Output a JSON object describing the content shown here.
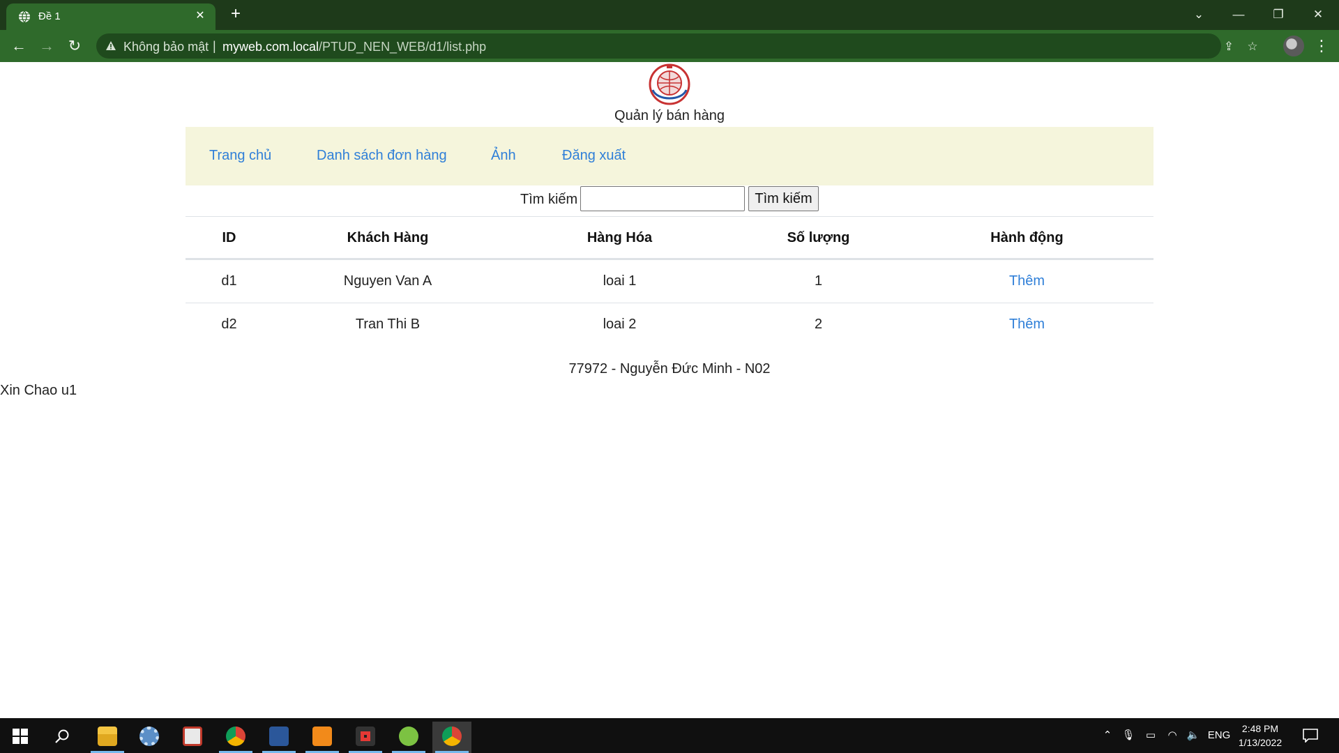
{
  "browser": {
    "tab_title": "Đề 1",
    "security_label": "Không bảo mật",
    "url_host": "myweb.com.local",
    "url_path": "/PTUD_NEN_WEB/d1/list.php"
  },
  "header": {
    "site_title": "Quản lý bán hàng"
  },
  "nav": {
    "items": [
      {
        "label": "Trang chủ"
      },
      {
        "label": "Danh sách đơn hàng"
      },
      {
        "label": "Ảnh"
      },
      {
        "label": "Đăng xuất"
      }
    ]
  },
  "search": {
    "label": "Tìm kiếm",
    "value": "",
    "button_label": "Tìm kiếm"
  },
  "table": {
    "columns": [
      "ID",
      "Khách Hàng",
      "Hàng Hóa",
      "Số lượng",
      "Hành động"
    ],
    "rows": [
      {
        "id": "d1",
        "customer": "Nguyen Van A",
        "product": "loai 1",
        "quantity": "1",
        "action": "Thêm"
      },
      {
        "id": "d2",
        "customer": "Tran Thi B",
        "product": "loai 2",
        "quantity": "2",
        "action": "Thêm"
      }
    ]
  },
  "footer": {
    "text": "77972 - Nguyễn Đức Minh - N02"
  },
  "greeting": "Xin Chao u1",
  "taskbar": {
    "language": "ENG",
    "time": "2:48 PM",
    "date": "1/13/2022",
    "apps": [
      "file-explorer",
      "settings",
      "snipping-tool",
      "chrome",
      "word",
      "sublime-text",
      "recorder",
      "coccoc",
      "chrome"
    ]
  },
  "colors": {
    "tab_bar": "#1e3a1a",
    "toolbar": "#2f6a2b",
    "nav_background": "#f5f5dc",
    "link": "#2f7fd8",
    "taskbar": "#101010"
  }
}
